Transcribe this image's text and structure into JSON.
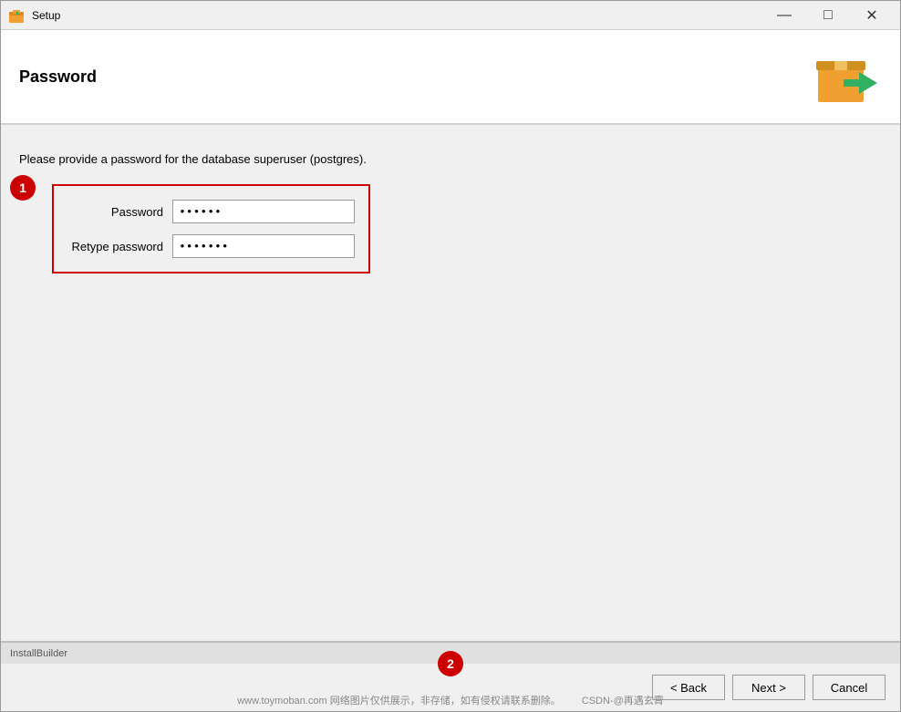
{
  "window": {
    "title": "Setup",
    "icon": "setup-icon"
  },
  "titlebar": {
    "minimize_label": "—",
    "maximize_label": "□",
    "close_label": "✕"
  },
  "header": {
    "title": "Password",
    "logo_alt": "setup-box-icon"
  },
  "content": {
    "instruction": "Please provide a password for the database superuser (postgres).",
    "password_label": "Password",
    "retype_label": "Retype password",
    "password_value": "******",
    "retype_value": "*******"
  },
  "annotations": {
    "circle1_label": "1",
    "circle2_label": "2"
  },
  "footer": {
    "installbuilder_label": "InstallBuilder",
    "back_label": "< Back",
    "next_label": "Next >",
    "cancel_label": "Cancel"
  },
  "watermark": {
    "text": "www.toymoban.com 网络图片仅供展示，非存储，如有侵权请联系删除。",
    "csdn_text": "CSDN-@再遇玄霄"
  }
}
